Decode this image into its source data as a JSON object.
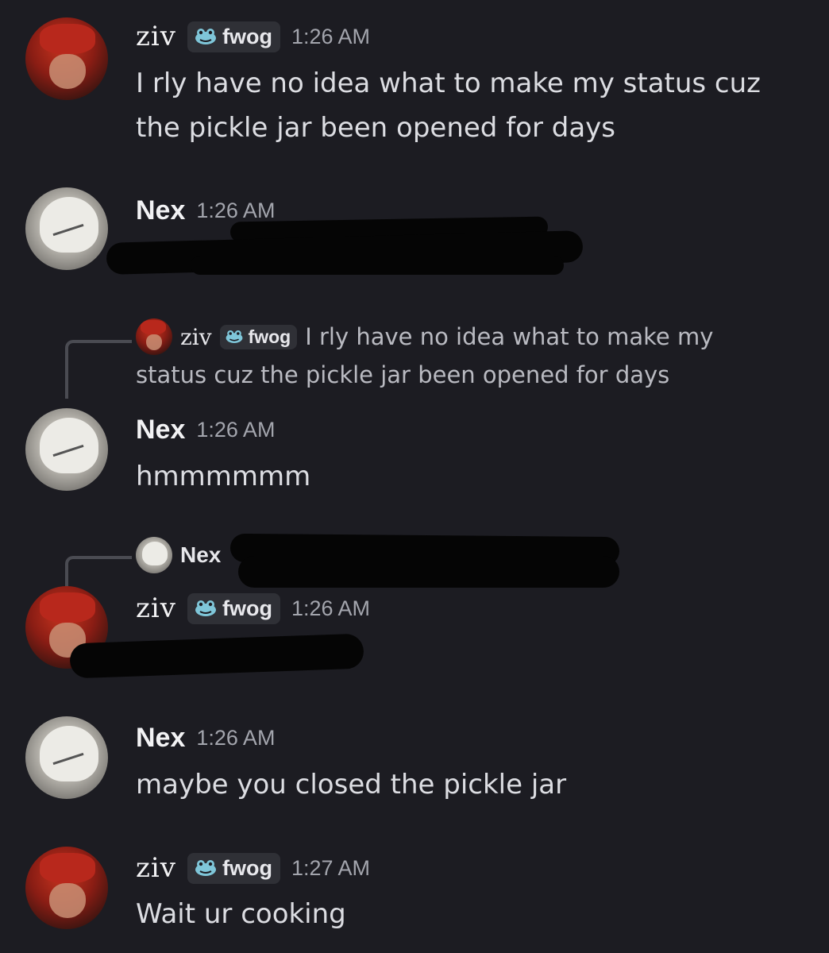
{
  "messages": [
    {
      "author": "ziv",
      "tag": "fwog",
      "time": "1:26 AM",
      "text": "I rly have no idea what to make my status cuz the pickle jar been opened for days"
    },
    {
      "author": "Nex",
      "time": "1:26 AM",
      "text": ""
    },
    {
      "reply": {
        "author": "ziv",
        "tag": "fwog",
        "text_line1": "I rly have no idea what to make my",
        "text_line2": "status cuz the pickle jar been opened for days"
      },
      "author": "Nex",
      "time": "1:26 AM",
      "text": "hmmmmmm"
    },
    {
      "reply": {
        "author": "Nex",
        "text": ""
      },
      "author": "ziv",
      "tag": "fwog",
      "time": "1:26 AM",
      "text": ""
    },
    {
      "author": "Nex",
      "time": "1:26 AM",
      "text": "maybe you closed the pickle jar"
    },
    {
      "author": "ziv",
      "tag": "fwog",
      "time": "1:27 AM",
      "text": "Wait ur cooking"
    }
  ],
  "icons": {
    "tag_icon": "frog-icon"
  },
  "colors": {
    "background": "#1c1c22",
    "tag_bg": "#2f3036",
    "timestamp": "#a3a5ad",
    "redaction": "#050505"
  }
}
